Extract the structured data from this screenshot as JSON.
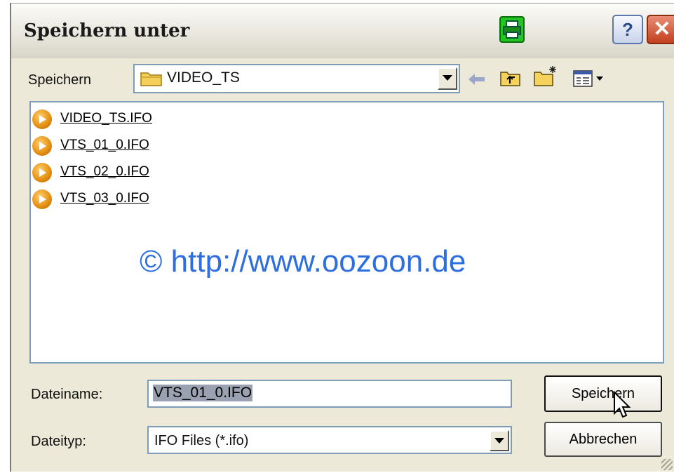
{
  "window": {
    "title": "Speichern unter",
    "help_label": "?",
    "close_label": "✕"
  },
  "save_in": {
    "label": "Speichern",
    "value": "VIDEO_TS"
  },
  "toolbar": {
    "icons": [
      "back-arrow-icon",
      "up-folder-icon",
      "new-folder-icon",
      "view-menu-icon"
    ]
  },
  "files": [
    {
      "name": "VIDEO_TS.IFO",
      "icon": "dvd-icon"
    },
    {
      "name": "VTS_01_0.IFO",
      "icon": "dvd-icon"
    },
    {
      "name": "VTS_02_0.IFO",
      "icon": "dvd-icon"
    },
    {
      "name": "VTS_03_0.IFO",
      "icon": "dvd-icon"
    }
  ],
  "watermark": "© http://www.oozoon.de",
  "filename": {
    "label": "Dateiname:",
    "value": "VTS_01_0.IFO"
  },
  "filetype": {
    "label": "Dateityp:",
    "value": "IFO Files (*.ifo)"
  },
  "buttons": {
    "save": "Speichern",
    "cancel": "Abbrechen"
  },
  "colors": {
    "watermark": "#2d6ee0",
    "printer": "#22c522",
    "close": "#c1401f"
  }
}
